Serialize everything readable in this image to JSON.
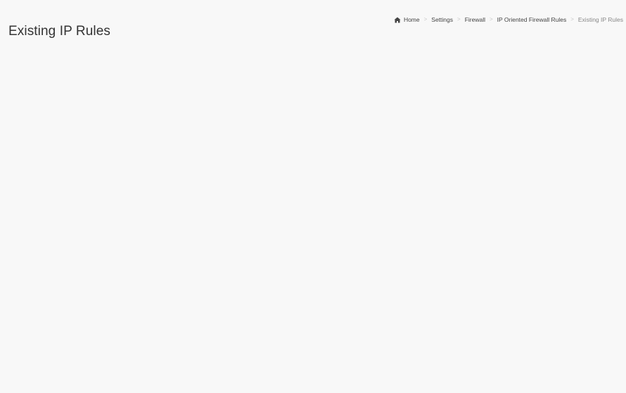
{
  "page": {
    "title": "Existing IP Rules",
    "background_color": "#f8f8f8"
  },
  "breadcrumb": {
    "home_icon": "home-icon",
    "items": [
      {
        "label": "Home"
      },
      {
        "label": "Settings"
      },
      {
        "label": "Firewall"
      },
      {
        "label": "IP Oriented Firewall Rules"
      },
      {
        "label": "Existing IP Rules"
      }
    ],
    "separator": ">"
  }
}
